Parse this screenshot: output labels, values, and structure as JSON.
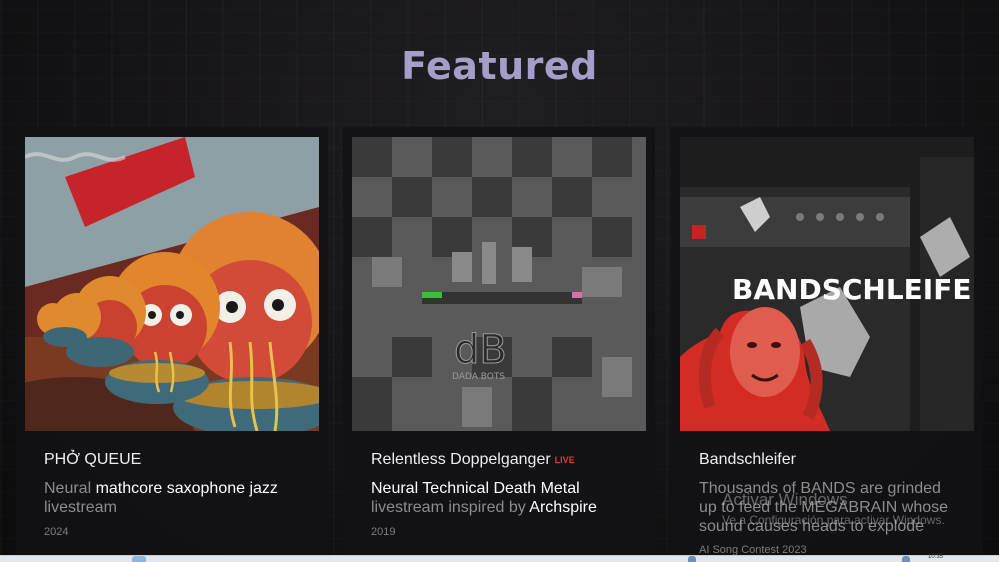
{
  "section": {
    "title": "Featured"
  },
  "cards": [
    {
      "title": "PHỞ QUEUE",
      "live": "",
      "desc_pre": "Neural ",
      "desc_em": "mathcore saxophone jazz",
      "desc_post": " livestream",
      "year": "2024"
    },
    {
      "title": "Relentless Doppelganger",
      "live": "LIVE",
      "desc_em1": "Neural Technical Death Metal",
      "desc_mid": " livestream inspired by ",
      "desc_em2": "Archspire",
      "year": "2019"
    },
    {
      "title": "Bandschleifer",
      "art_text": "BANDSCHLEIFER",
      "desc": "Thousands of BANDS are grinded up to feed the MEGABRAIN whose sound causes heads to explode",
      "year": "AI Song Contest 2023"
    }
  ],
  "watermark": {
    "line1": "Activar Windows",
    "line2": "Ve a Configuración para activar Windows."
  },
  "taskbar": {
    "clock": "10:35"
  },
  "colors": {
    "title": "#a49ec9",
    "live": "#e2342d",
    "card_bg": "#121214"
  }
}
